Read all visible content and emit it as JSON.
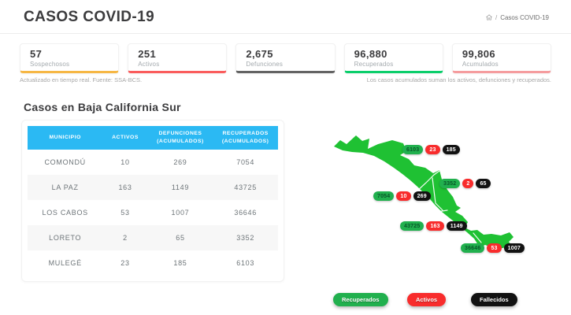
{
  "header": {
    "title": "CASOS COVID-19",
    "breadcrumb": {
      "separator": "/",
      "current": "Casos COVID-19"
    }
  },
  "stats": [
    {
      "value": "57",
      "label": "Sospechosos",
      "accent": "#f6b744"
    },
    {
      "value": "251",
      "label": "Activos",
      "accent": "#fa5c5c"
    },
    {
      "value": "2,675",
      "label": "Defunciones",
      "accent": "#636363"
    },
    {
      "value": "96,880",
      "label": "Recuperados",
      "accent": "#0bce6b"
    },
    {
      "value": "99,806",
      "label": "Acumulados",
      "accent": "#f59c9e"
    }
  ],
  "notes": {
    "left": "Actualizado en tiempo real. Fuente: SSA-BCS.",
    "right": "Los casos acumulados suman los activos, defunciones y recuperados."
  },
  "section": {
    "title": "Casos en Baja California Sur"
  },
  "table": {
    "header_bg": "#2bb9f3",
    "headers": [
      {
        "line1": "MUNICIPIO",
        "line2": ""
      },
      {
        "line1": "ACTIVOS",
        "line2": ""
      },
      {
        "line1": "DEFUNCIONES",
        "line2": "(ACUMULADOS)"
      },
      {
        "line1": "RECUPERADOS",
        "line2": "(ACUMULADOS)"
      }
    ],
    "rows": [
      {
        "municipio": "COMONDÚ",
        "activos": "10",
        "defunciones": "269",
        "recuperados": "7054"
      },
      {
        "municipio": "LA PAZ",
        "activos": "163",
        "defunciones": "1149",
        "recuperados": "43725"
      },
      {
        "municipio": "LOS CABOS",
        "activos": "53",
        "defunciones": "1007",
        "recuperados": "36646"
      },
      {
        "municipio": "LORETO",
        "activos": "2",
        "defunciones": "65",
        "recuperados": "3352"
      },
      {
        "municipio": "MULEGÉ",
        "activos": "23",
        "defunciones": "185",
        "recuperados": "6103"
      }
    ]
  },
  "map": {
    "land_color": "#1fc133",
    "badge_colors": {
      "recovered": "#21b04e",
      "active": "#f82c2c",
      "deaths": "#121212"
    },
    "municipalities": [
      {
        "name": "Mulegé",
        "recovered": "6103",
        "active": "23",
        "deaths": "185"
      },
      {
        "name": "Loreto",
        "recovered": "3352",
        "active": "2",
        "deaths": "65"
      },
      {
        "name": "Comondú",
        "recovered": "7054",
        "active": "10",
        "deaths": "269"
      },
      {
        "name": "La Paz",
        "recovered": "43725",
        "active": "163",
        "deaths": "1149"
      },
      {
        "name": "Los Cabos",
        "recovered": "36646",
        "active": "53",
        "deaths": "1007"
      }
    ]
  },
  "legend": [
    {
      "label": "Recuperados",
      "color": "#21b04e"
    },
    {
      "label": "Activos",
      "color": "#f82c2c"
    },
    {
      "label": "Fallecidos",
      "color": "#121212"
    }
  ]
}
